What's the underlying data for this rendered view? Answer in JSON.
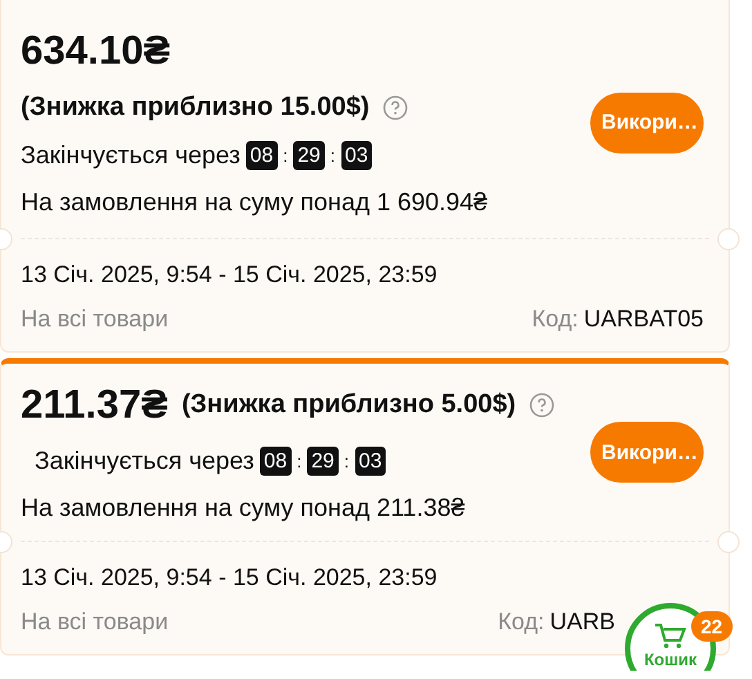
{
  "coupons": [
    {
      "kind": "stacked",
      "highlighted": false,
      "amount": "634.10₴",
      "discount": "(Знижка приблизно 15.00$)",
      "expires_label": "Закінчується через",
      "timer": [
        "08",
        "29",
        "03"
      ],
      "timer_separator": ":",
      "condition": "На замовлення на суму понад 1 690.94₴",
      "button": "Викори…",
      "dates": "13 Січ. 2025, 9:54 - 15 Січ. 2025, 23:59",
      "scope": "На всі товари",
      "code_label": "Код:",
      "code": "UARBAT05"
    },
    {
      "kind": "inline",
      "highlighted": true,
      "amount": "211.37₴",
      "discount": "(Знижка приблизно 5.00$)",
      "expires_label": "Закінчується через",
      "timer": [
        "08",
        "29",
        "03"
      ],
      "timer_separator": ":",
      "condition": "На замовлення на суму понад 211.38₴",
      "button": "Викори…",
      "dates": "13 Січ. 2025, 9:54 - 15 Січ. 2025, 23:59",
      "scope": "На всі товари",
      "code_label": "Код:",
      "code": "UARB"
    }
  ],
  "cart": {
    "label": "Кошик",
    "count": "22"
  }
}
